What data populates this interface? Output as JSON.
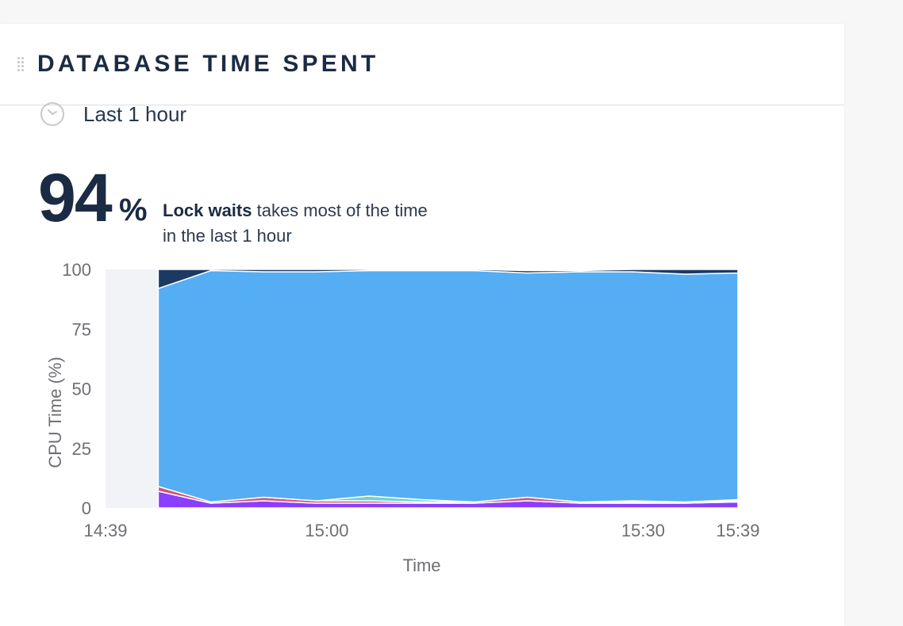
{
  "card": {
    "title": "DATABASE TIME SPENT",
    "time_range": "Last 1 hour",
    "headline_percent": "94",
    "headline_percent_sign": "%",
    "summary_bold": "Lock waits",
    "summary_line1_rest": " takes most of the time",
    "summary_line2": "in the last 1 hour"
  },
  "icons": {
    "drag": "drag-handle-icon",
    "clock": "clock-icon"
  },
  "colors": {
    "lock_waits": "#55adf4",
    "top_band": "#1b3a63",
    "purple": "#8a3ffc",
    "pink": "#d94f7c",
    "teal": "#6fd0d0",
    "no_data_bg": "#f2f3f6"
  },
  "chart_data": {
    "type": "area",
    "stacked": true,
    "title": "",
    "xlabel": "Time",
    "ylabel": "CPU Time (%)",
    "ylim": [
      0,
      100
    ],
    "yticks": [
      "0",
      "25",
      "50",
      "75",
      "100"
    ],
    "xlim": [
      "14:39",
      "15:39"
    ],
    "xticks": [
      {
        "label": "14:39",
        "minute": 0
      },
      {
        "label": "15:00",
        "minute": 21
      },
      {
        "label": "15:30",
        "minute": 51
      },
      {
        "label": "15:39",
        "minute": 60
      }
    ],
    "no_data_until_minute": 5,
    "x_minutes": [
      5,
      10,
      15,
      20,
      25,
      30,
      35,
      40,
      45,
      50,
      55,
      60
    ],
    "series": [
      {
        "color": "#8a3ffc",
        "values": [
          7,
          2,
          3,
          2,
          2,
          2,
          2,
          3,
          2,
          2,
          2,
          2.5
        ]
      },
      {
        "color": "#d94f7c",
        "values": [
          2,
          0.5,
          1.5,
          1,
          1,
          0.5,
          0.5,
          1.5,
          0.5,
          0.5,
          0.5,
          0.5
        ]
      },
      {
        "color": "#6fd0d0",
        "values": [
          0,
          0,
          0,
          0,
          2,
          1,
          0,
          0,
          0,
          0.5,
          0,
          0.5
        ]
      },
      {
        "color": "#55adf4",
        "values": [
          83,
          97,
          94.5,
          96,
          94.5,
          96,
          97,
          94,
          96.5,
          96,
          95.5,
          95
        ]
      },
      {
        "color": "#1b3a63",
        "values": [
          8,
          0.5,
          1,
          1,
          0.5,
          0.5,
          0.5,
          1,
          0.5,
          1,
          2,
          1.5
        ]
      }
    ]
  }
}
